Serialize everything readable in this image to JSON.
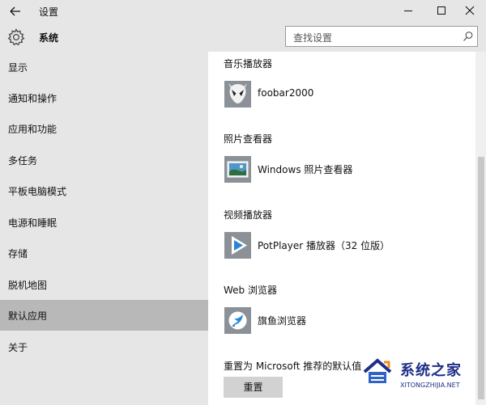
{
  "window": {
    "title": "设置",
    "back_icon": "arrow-left-icon",
    "minimize_icon": "minimize-icon",
    "maximize_icon": "maximize-icon",
    "close_icon": "close-icon"
  },
  "header": {
    "icon": "gear-icon",
    "title": "系统",
    "search_placeholder": "查找设置",
    "search_icon": "search-icon"
  },
  "sidebar": {
    "items": [
      {
        "label": "显示",
        "selected": false
      },
      {
        "label": "通知和操作",
        "selected": false
      },
      {
        "label": "应用和功能",
        "selected": false
      },
      {
        "label": "多任务",
        "selected": false
      },
      {
        "label": "平板电脑模式",
        "selected": false
      },
      {
        "label": "电源和睡眠",
        "selected": false
      },
      {
        "label": "存储",
        "selected": false
      },
      {
        "label": "脱机地图",
        "selected": false
      },
      {
        "label": "默认应用",
        "selected": true
      },
      {
        "label": "关于",
        "selected": false
      }
    ]
  },
  "main": {
    "sections": [
      {
        "title": "音乐播放器",
        "app": "foobar2000",
        "icon": "foobar-alien-icon"
      },
      {
        "title": "照片查看器",
        "app": "Windows 照片查看器",
        "icon": "photo-viewer-icon"
      },
      {
        "title": "视频播放器",
        "app": "PotPlayer 播放器（32 位版）",
        "icon": "play-icon"
      },
      {
        "title": "Web 浏览器",
        "app": "旗鱼浏览器",
        "icon": "sailfish-browser-icon"
      }
    ],
    "reset_label": "重置为 Microsoft 推荐的默认值",
    "reset_button": "重置"
  },
  "watermark": {
    "brand": "系统之家",
    "url": "XITONGZHIJIA.NET"
  },
  "colors": {
    "chrome": "#e6e6e6",
    "selected": "#b8b8b8",
    "tile": "#8b9196",
    "button": "#d2d2d2",
    "watermark": "#1f2f88"
  }
}
